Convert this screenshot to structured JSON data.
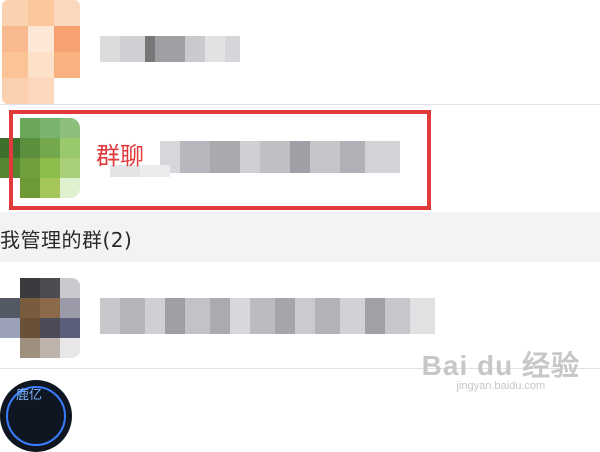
{
  "list": {
    "section_header": "我管理的群(2)",
    "highlighted_group": {
      "name_label": "群聊"
    },
    "bottom_avatar_text": "鹿亿"
  },
  "watermark": {
    "logo": "Bai du 经验",
    "subtitle": "jingyan.baidu.com"
  },
  "colors": {
    "highlight_border": "#e23a3c",
    "label_red": "#e0393b",
    "section_bg": "#f3f3f5",
    "divider": "#e2e2e6"
  }
}
